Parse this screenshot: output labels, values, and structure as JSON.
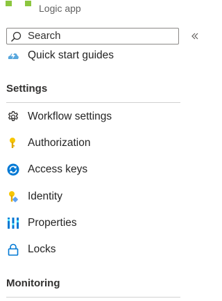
{
  "header": {
    "subtitle": "Logic app"
  },
  "search": {
    "placeholder": "Search"
  },
  "nav": {
    "quick_start": "Quick start guides",
    "settings_header": "Settings",
    "workflow_settings": "Workflow settings",
    "authorization": "Authorization",
    "access_keys": "Access keys",
    "identity": "Identity",
    "properties": "Properties",
    "locks": "Locks",
    "monitoring_header": "Monitoring"
  },
  "colors": {
    "logo_green": "#8cc63f",
    "key_yellow": "#f7c600",
    "azure_blue": "#0078d4",
    "quickstart_blue": "#58a7dd"
  },
  "icons": {
    "search": "search-icon",
    "collapse": "double-chevron-left-icon",
    "quick_start": "cloud-lightning-icon",
    "workflow_settings": "gear-icon",
    "authorization": "key-icon",
    "access_keys": "refresh-key-icon",
    "identity": "identity-key-icon",
    "properties": "properties-bars-icon",
    "locks": "lock-icon"
  }
}
